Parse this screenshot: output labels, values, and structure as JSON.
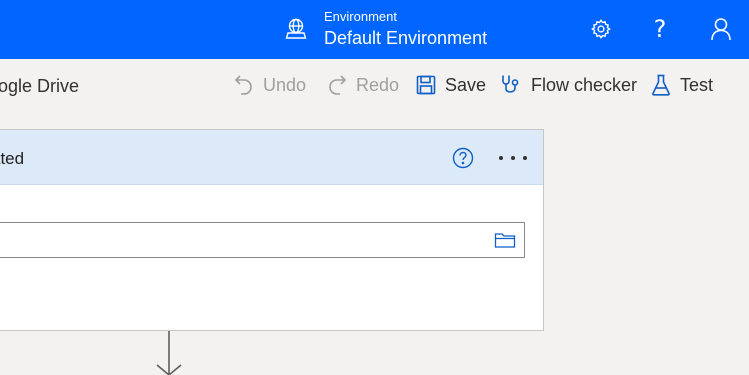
{
  "header": {
    "environment_label": "Environment",
    "environment_name": "Default Environment",
    "icons": [
      "globe-environment-icon",
      "gear-icon",
      "help-icon",
      "user-icon"
    ],
    "background_color": "#0066ff"
  },
  "command_bar": {
    "flow_name_visible": "ogle Drive",
    "undo_label": "Undo",
    "redo_label": "Redo",
    "save_label": "Save",
    "flow_checker_label": "Flow checker",
    "test_label": "Test"
  },
  "card": {
    "title_visible": "ated",
    "header_color": "#dbe9f8",
    "field_value": "",
    "icons": [
      "help-circle-icon",
      "more-options-icon",
      "folder-picker-icon"
    ]
  },
  "canvas": {
    "connector_icon": "down-arrow-icon"
  }
}
